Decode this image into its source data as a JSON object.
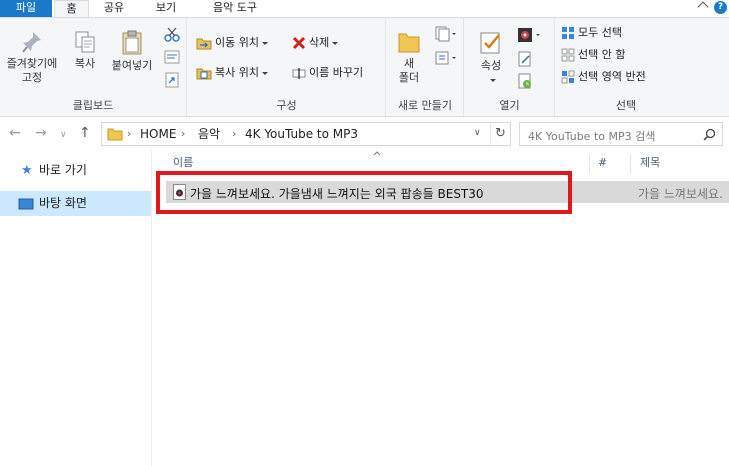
{
  "ribbon_tabs": {
    "file": "파일",
    "home": "홈",
    "share": "공유",
    "view": "보기",
    "music_tools": "음악 도구"
  },
  "clipboard": {
    "pin_label_1": "즐겨찾기에",
    "pin_label_2": "고정",
    "copy_label": "복사",
    "paste_label": "붙여넣기",
    "group_label": "클립보드"
  },
  "organize": {
    "move_to": "이동 위치",
    "copy_to": "복사 위치",
    "delete": "삭제",
    "rename": "이름 바꾸기",
    "group_label": "구성"
  },
  "new": {
    "new_folder_1": "새",
    "new_folder_2": "폴더",
    "group_label": "새로 만들기"
  },
  "open": {
    "properties": "속성",
    "group_label": "열기"
  },
  "select": {
    "select_all": "모두 선택",
    "select_none": "선택 안 함",
    "invert": "선택 영역 반전",
    "group_label": "선택"
  },
  "address": {
    "crumbs": [
      "HOME",
      "음악",
      "4K YouTube to MP3"
    ],
    "search_placeholder": "4K YouTube to MP3 검색"
  },
  "nav_pane": {
    "items": [
      {
        "label": "바로 가기",
        "icon": "star-icon"
      },
      {
        "label": "바탕 화면",
        "icon": "desktop-icon",
        "selected": true
      }
    ]
  },
  "columns": {
    "name": "이름",
    "number": "#",
    "title": "제목"
  },
  "files": [
    {
      "name": "가을 느껴보세요. 가을냄새 느껴지는 외국 팝송들 BEST30",
      "title": "가을 느껴보세요.",
      "icon": "audio-file-icon"
    }
  ],
  "colors": {
    "file_tab": "#1979ca",
    "highlight_box": "#e0181c",
    "selected_row": "#d9d9d9",
    "nav_selected": "#cce8ff"
  }
}
